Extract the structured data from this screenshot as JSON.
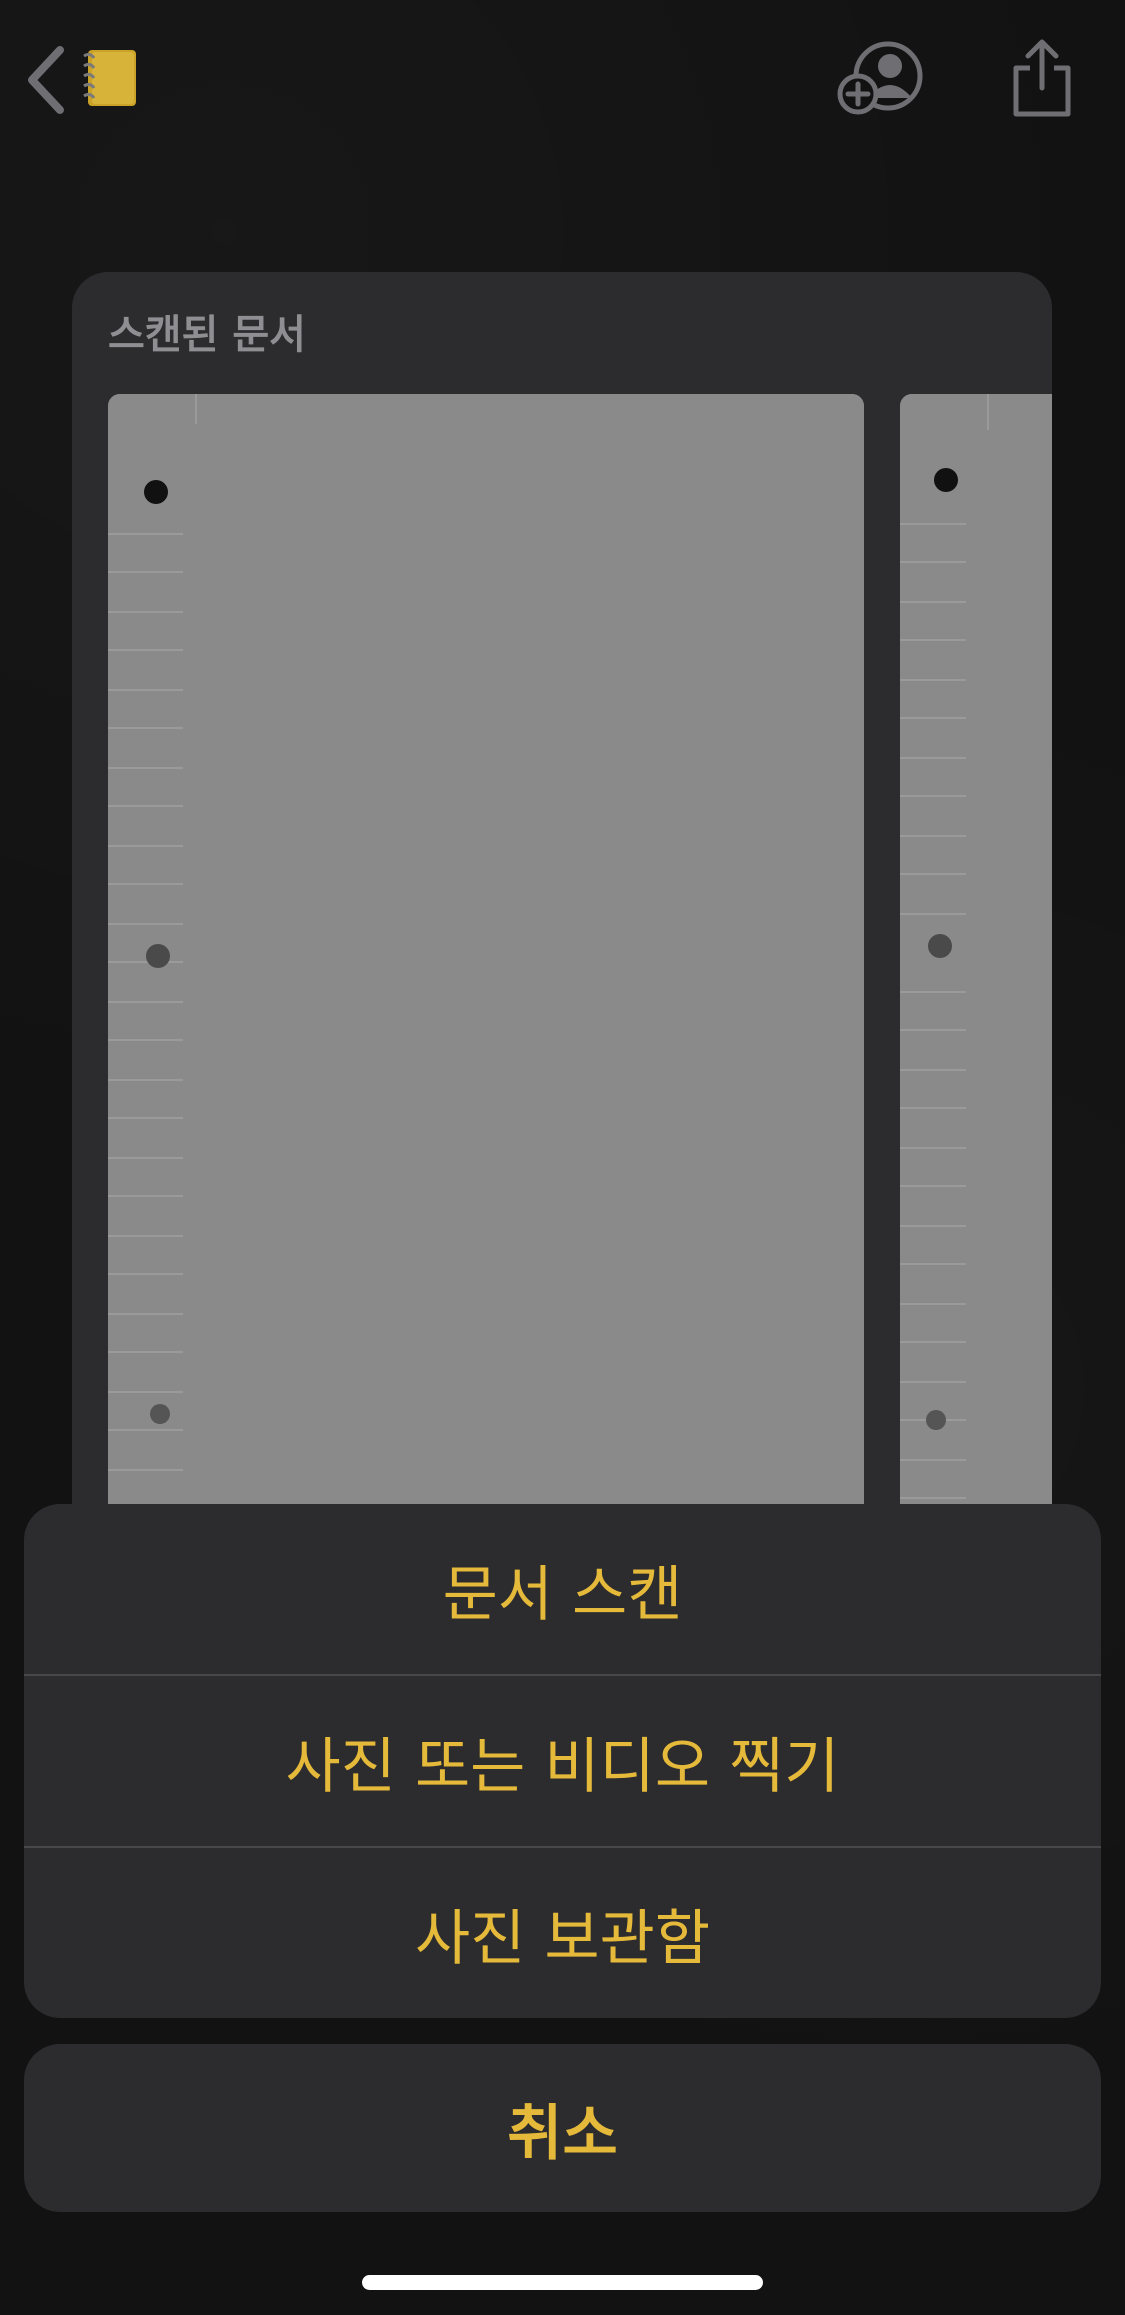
{
  "topbar": {
    "back_icon": "chevron-left-icon",
    "notes_icon": "notebook-icon",
    "share_person_icon": "person-add-icon",
    "share_icon": "share-icon"
  },
  "card": {
    "title": "스캔된 문서"
  },
  "action_sheet": {
    "actions": [
      {
        "label": "문서 스캔"
      },
      {
        "label": "사진 또는 비디오 찍기"
      },
      {
        "label": "사진 보관함"
      }
    ],
    "cancel_label": "취소"
  },
  "colors": {
    "accent": "#e5b93a",
    "sheet_bg": "#2c2c2e",
    "background": "#121212",
    "page_gray": "#8a8a8a"
  }
}
